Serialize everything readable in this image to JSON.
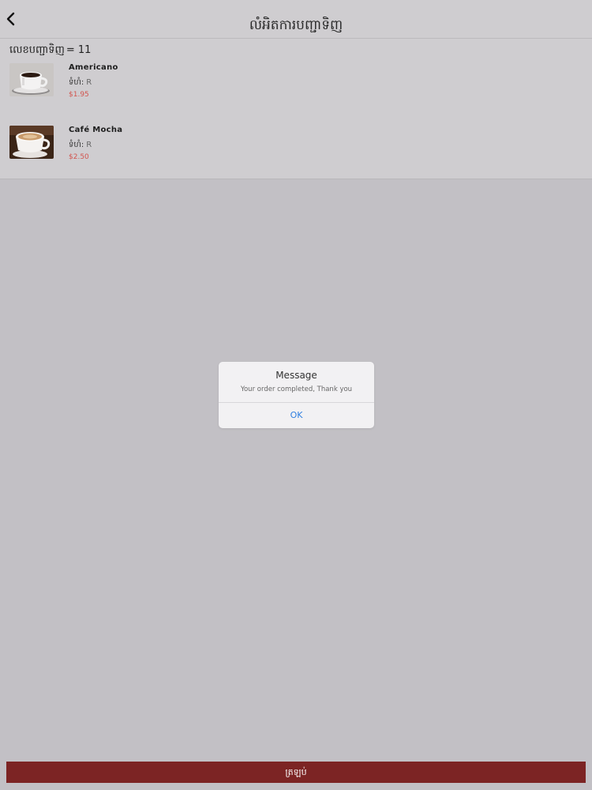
{
  "header": {
    "title": "លំអិតការបញ្ជាទិញ",
    "back_icon": "chevron-left-icon"
  },
  "order": {
    "count_label": "លេខបញ្ជាទិញ",
    "count_value": "= 11",
    "items": [
      {
        "name": "Americano",
        "size_label": "ទំហំ:",
        "size_value": "R",
        "price": "$1.95",
        "image": "coffee-cup-image"
      },
      {
        "name": "Café Mocha",
        "size_label": "ទំហំ:",
        "size_value": "R",
        "price": "$2.50",
        "image": "coffee-cup-image"
      }
    ]
  },
  "dialog": {
    "title": "Message",
    "message": "Your order completed, Thank you",
    "ok_label": "OK"
  },
  "footer": {
    "checkout_label": "ត្រឡប់"
  },
  "colors": {
    "accent": "#7c2424",
    "price": "#d2554f",
    "link": "#2f7fe0",
    "overlay": "#c2c0c5"
  }
}
